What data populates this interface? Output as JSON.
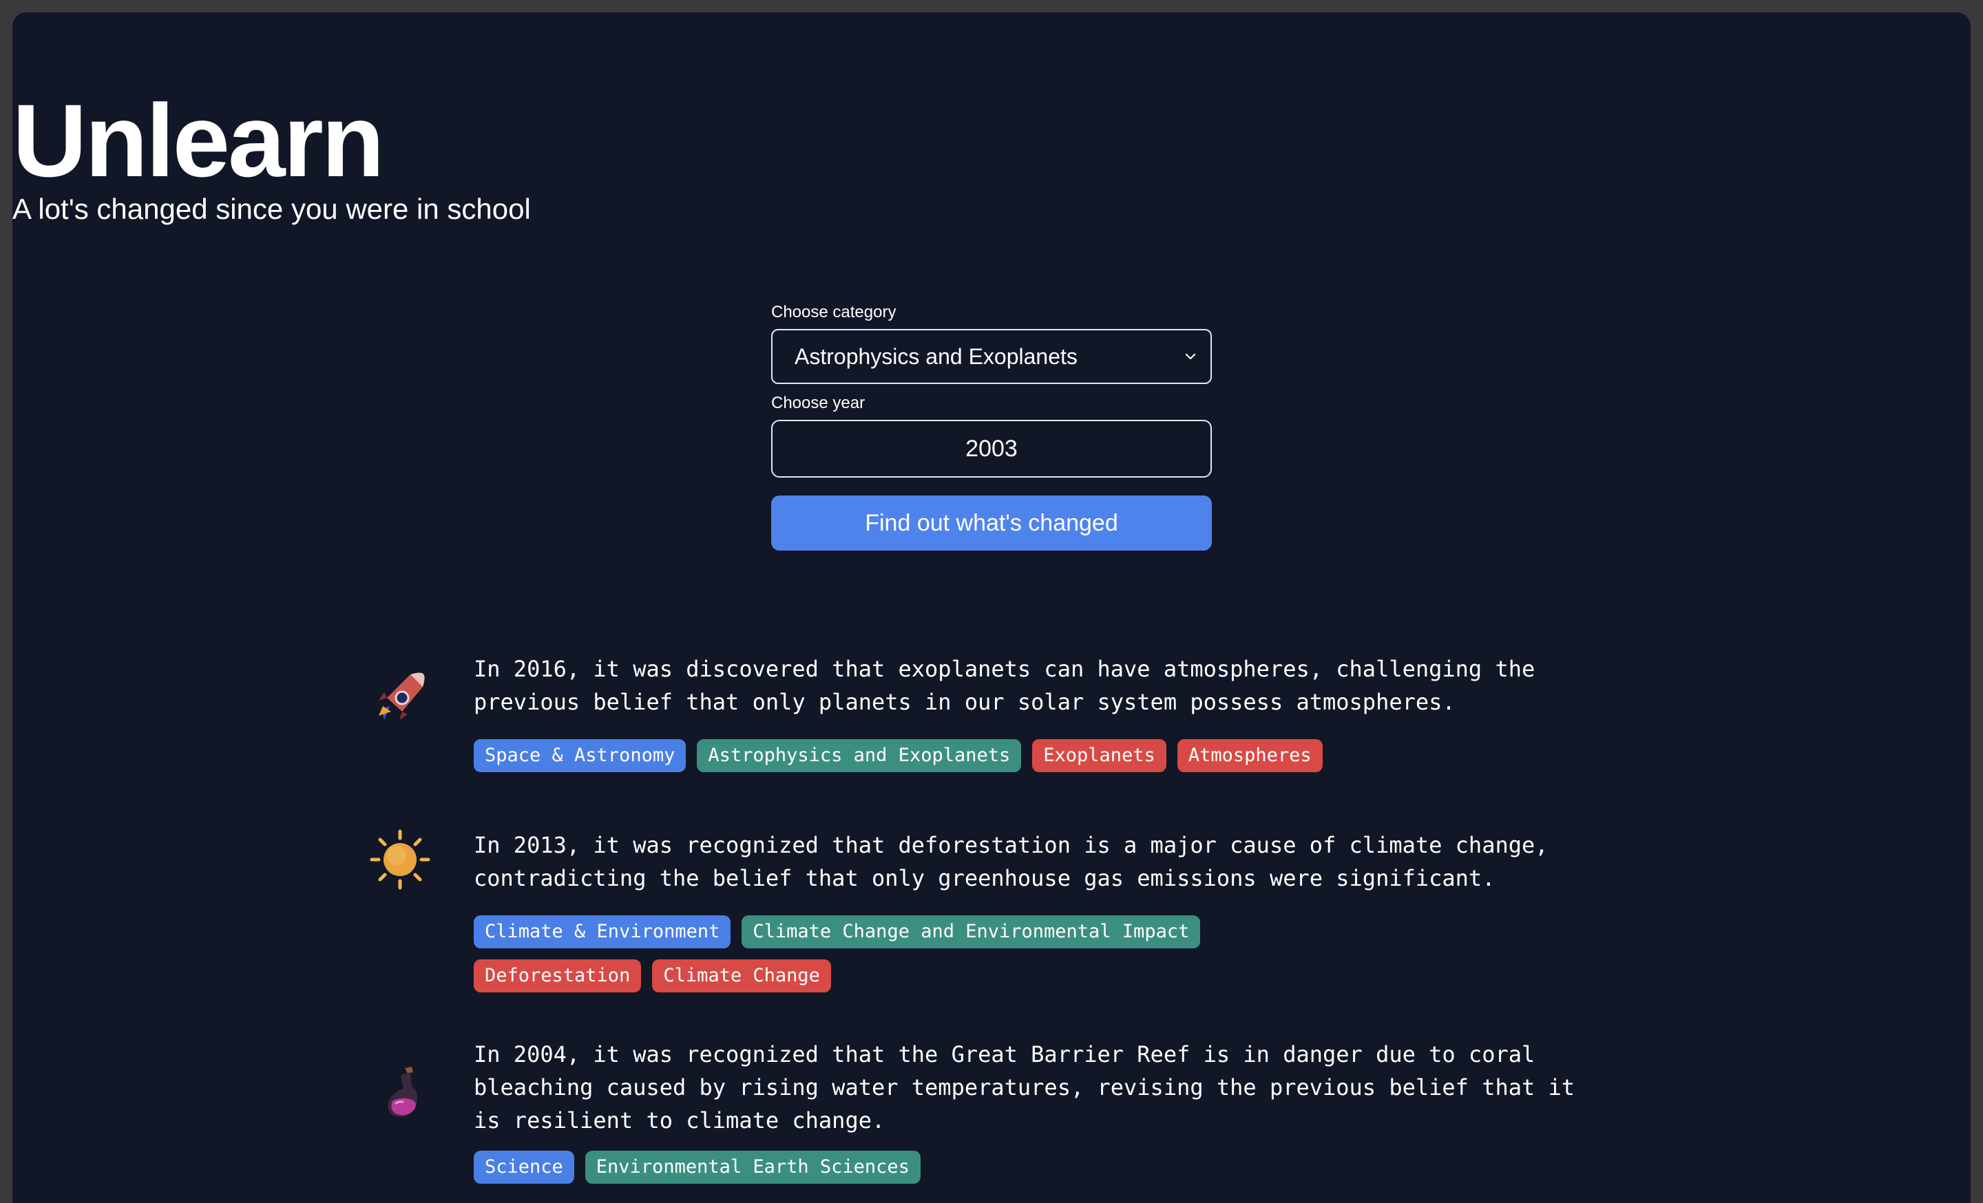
{
  "app": {
    "title": "Unlearn",
    "subtitle": "A lot's changed since you were in school"
  },
  "form": {
    "category_label": "Choose category",
    "category_value": "Astrophysics and Exoplanets",
    "year_label": "Choose year",
    "year_value": "2003",
    "submit_label": "Find out what's changed"
  },
  "facts": [
    {
      "icon": "rocket-icon",
      "text": "In 2016, it was discovered that exoplanets can have atmospheres, challenging the\nprevious belief that only planets in our solar system possess atmospheres.",
      "tags": [
        {
          "label": "Space & Astronomy",
          "color": "#4a7fe6"
        },
        {
          "label": "Astrophysics and Exoplanets",
          "color": "#3b8f80"
        },
        {
          "label": "Exoplanets",
          "color": "#d84a45"
        },
        {
          "label": "Atmospheres",
          "color": "#d84a45"
        }
      ]
    },
    {
      "icon": "sun-icon",
      "text": "In 2013, it was recognized that deforestation is a major cause of climate change,\ncontradicting the belief that only greenhouse gas emissions were significant.",
      "tags": [
        {
          "label": "Climate & Environment",
          "color": "#4a7fe6"
        },
        {
          "label": "Climate Change and Environmental Impact",
          "color": "#3b8f80"
        },
        {
          "label": "Deforestation",
          "color": "#d84a45"
        },
        {
          "label": "Climate Change",
          "color": "#d84a45"
        }
      ]
    },
    {
      "icon": "potion-flask-icon",
      "text": "In 2004, it was recognized that the Great Barrier Reef is in danger due to coral\nbleaching caused by rising water temperatures, revising the previous belief that it\nis resilient to climate change.",
      "tags": [
        {
          "label": "Science",
          "color": "#4a7fe6"
        },
        {
          "label": "Environmental Earth Sciences",
          "color": "#3b8f80"
        }
      ]
    }
  ],
  "colors": {
    "background": "#111726",
    "primary_button": "#4f83ec",
    "tag_category": "#4a7fe6",
    "tag_subcategory": "#3b8f80",
    "tag_topic": "#d84a45"
  }
}
